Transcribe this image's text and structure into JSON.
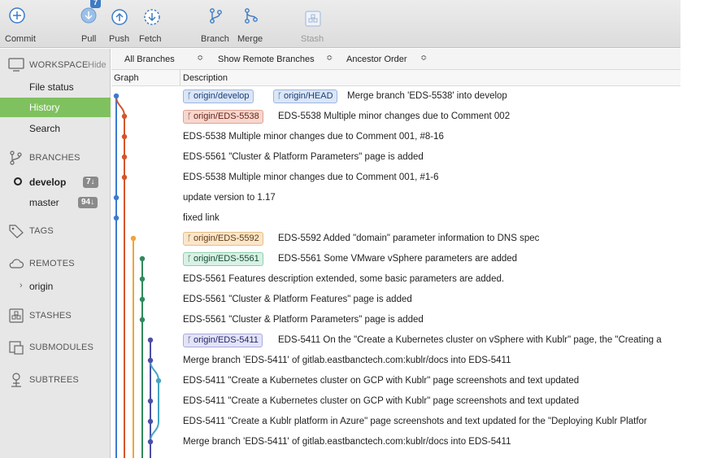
{
  "toolbar": {
    "commit_label": "Commit",
    "pull_label": "Pull",
    "pull_badge": "7",
    "push_label": "Push",
    "fetch_label": "Fetch",
    "branch_label": "Branch",
    "merge_label": "Merge",
    "stash_label": "Stash"
  },
  "sidebar": {
    "workspace_label": "WORKSPACE",
    "workspace_hide": "Hide",
    "workspace_items": [
      {
        "label": "File status"
      },
      {
        "label": "History"
      },
      {
        "label": "Search"
      }
    ],
    "branches_label": "BRANCHES",
    "branches": [
      {
        "label": "develop",
        "count": "7↓"
      },
      {
        "label": "master",
        "count": "94↓"
      }
    ],
    "tags_label": "TAGS",
    "remotes_label": "REMOTES",
    "remote_items": [
      {
        "label": "origin"
      }
    ],
    "stashes_label": "STASHES",
    "submodules_label": "SUBMODULES",
    "subtrees_label": "SUBTREES"
  },
  "filters": {
    "branches": "All Branches",
    "remote": "Show Remote Branches",
    "order": "Ancestor Order"
  },
  "columns": {
    "graph": "Graph",
    "description": "Description"
  },
  "commits": [
    {
      "tags": [
        {
          "text": "origin/develop"
        },
        {
          "text": "origin/HEAD"
        }
      ],
      "desc": "Merge branch 'EDS-5538' into develop"
    },
    {
      "tags": [
        {
          "text": "origin/EDS-5538"
        }
      ],
      "desc": "EDS-5538 Multiple minor changes due to Comment 002"
    },
    {
      "tags": [],
      "desc": "EDS-5538 Multiple minor changes due to Comment 001, #8-16"
    },
    {
      "tags": [],
      "desc": "EDS-5561 \"Cluster & Platform Parameters\" page is added"
    },
    {
      "tags": [],
      "desc": "EDS-5538 Multiple minor changes due to Comment 001, #1-6"
    },
    {
      "tags": [],
      "desc": "update version to 1.17"
    },
    {
      "tags": [],
      "desc": "fixed link"
    },
    {
      "tags": [
        {
          "text": "origin/EDS-5592"
        }
      ],
      "desc": "EDS-5592 Added \"domain\" parameter information to DNS spec"
    },
    {
      "tags": [
        {
          "text": "origin/EDS-5561"
        }
      ],
      "desc": "EDS-5561 Some VMware vSphere parameters are added"
    },
    {
      "tags": [],
      "desc": "EDS-5561 Features description extended, some basic parameters are added."
    },
    {
      "tags": [],
      "desc": "EDS-5561 \"Cluster & Platform Features\" page is added"
    },
    {
      "tags": [],
      "desc": "EDS-5561 \"Cluster & Platform Parameters\" page is added"
    },
    {
      "tags": [
        {
          "text": "origin/EDS-5411"
        }
      ],
      "desc": "EDS-5411 On the \"Create a Kubernetes cluster on vSphere with Kublr\" page, the \"Creating a"
    },
    {
      "tags": [],
      "desc": "Merge branch 'EDS-5411' of gitlab.eastbanctech.com:kublr/docs into EDS-5411"
    },
    {
      "tags": [],
      "desc": "EDS-5411 \"Create a Kubernetes cluster on GCP with Kublr\" page screenshots and text updated"
    },
    {
      "tags": [],
      "desc": "EDS-5411 \"Create a Kubernetes cluster on GCP with Kublr\" page screenshots and text updated"
    },
    {
      "tags": [],
      "desc": "EDS-5411 \"Create a Kublr platform in Azure\" page screenshots and text updated for the \"Deploying Kublr Platfor"
    },
    {
      "tags": [],
      "desc": "Merge branch 'EDS-5411' of gitlab.eastbanctech.com:kublr/docs into EDS-5411"
    }
  ],
  "colors": {
    "history_active": "#7fc15e",
    "lane_blue": "#3b7ad0",
    "lane_red": "#d4562c",
    "lane_orange": "#f2a33a",
    "lane_green": "#2f8a5b",
    "lane_purple": "#4b4fa8",
    "lane_cyan": "#45a5c6"
  }
}
